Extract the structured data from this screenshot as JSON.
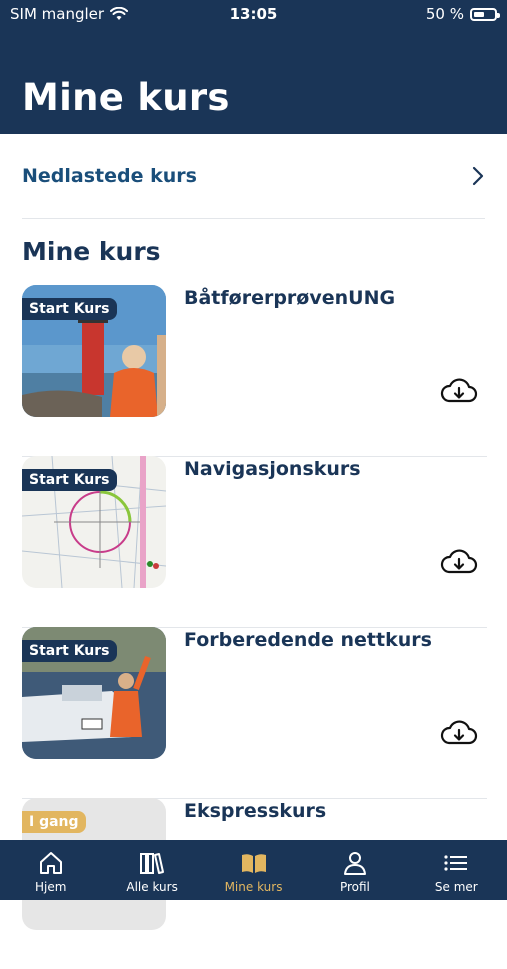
{
  "status": {
    "carrier": "SIM mangler",
    "time": "13:05",
    "battery": "50 %",
    "battery_level": 0.5
  },
  "header": {
    "title": "Mine kurs"
  },
  "downloaded": {
    "label": "Nedlastede kurs"
  },
  "section_title": "Mine kurs",
  "courses": [
    {
      "name": "BåtførerprøvenUNG",
      "badge": "Start Kurs"
    },
    {
      "name": "Navigasjonskurs",
      "badge": "Start Kurs"
    },
    {
      "name": "Forberedende nettkurs",
      "badge": "Start Kurs"
    },
    {
      "name": "Ekspresskurs",
      "badge": "I gang"
    }
  ],
  "tabs": [
    {
      "label": "Hjem",
      "icon": "home-icon"
    },
    {
      "label": "Alle kurs",
      "icon": "books-icon"
    },
    {
      "label": "Mine kurs",
      "icon": "book-open-icon",
      "active": true
    },
    {
      "label": "Profil",
      "icon": "person-icon"
    },
    {
      "label": "Se mer",
      "icon": "list-icon"
    }
  ],
  "colors": {
    "navy": "#1a3557",
    "accent": "#e2b660",
    "link": "#1a4e7a"
  }
}
